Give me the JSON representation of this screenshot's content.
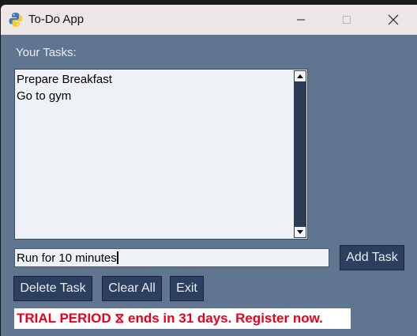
{
  "window": {
    "title": "To-Do App",
    "app_icon": "python-logo-icon",
    "controls": [
      "minimize-icon",
      "maximize-icon",
      "close-icon"
    ]
  },
  "tasks_label": "Your Tasks:",
  "tasks": [
    "Prepare Breakfast",
    "Go to gym"
  ],
  "entry": {
    "value": "Run for 10 minutes"
  },
  "buttons": {
    "add": "Add Task",
    "delete": "Delete Task",
    "clear": "Clear All",
    "exit": "Exit"
  },
  "trial_banner": "TRIAL PERIOD ⧖ ends in 31 days. Register now.",
  "colors": {
    "window_bg": "#5f7590",
    "button_bg": "#2c3f5e",
    "banner_text": "#e8001c"
  }
}
